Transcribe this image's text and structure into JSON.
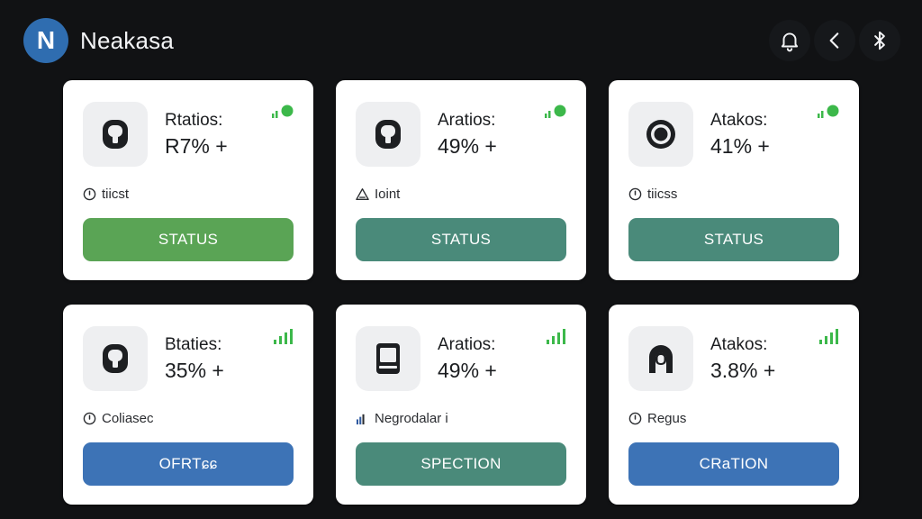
{
  "app": {
    "logo_letter": "N",
    "title": "Neakasa"
  },
  "header": {
    "icons": [
      "bell-icon",
      "back-icon",
      "bluetooth-icon"
    ]
  },
  "colors": {
    "green": "#5aa455",
    "teal": "#4a8a7a",
    "blue": "#3d73b6",
    "signal": "#3cb84a"
  },
  "cards": [
    {
      "label": "Rtatios:",
      "value": "R7% +",
      "meta": "tiicst",
      "meta_icon": "clock-icon",
      "button": "STATUS",
      "button_color": "green",
      "icon": "robot-vacuum-icon",
      "signal": "dot"
    },
    {
      "label": "Aratios:",
      "value": "49% +",
      "meta": "Ioint",
      "meta_icon": "warning-icon",
      "button": "STATUS",
      "button_color": "teal",
      "icon": "robot-vacuum-icon",
      "signal": "dot"
    },
    {
      "label": "Atakos:",
      "value": "41% +",
      "meta": "tiicss",
      "meta_icon": "clock-icon",
      "button": "STATUS",
      "button_color": "teal",
      "icon": "target-icon",
      "signal": "dot"
    },
    {
      "label": "Btaties:",
      "value": "35% +",
      "meta": "Coliasec",
      "meta_icon": "clock-icon",
      "button": "OFRTɕɕ",
      "button_color": "blue",
      "icon": "robot-vacuum-icon",
      "signal": "bars"
    },
    {
      "label": "Aratios:",
      "value": "49% +",
      "meta": "Negrodalar i",
      "meta_icon": "chart-icon",
      "button": "SPECTION",
      "button_color": "teal",
      "icon": "device-icon",
      "signal": "bars"
    },
    {
      "label": "Atakos:",
      "value": "3.8% +",
      "meta": "Regus",
      "meta_icon": "clock-icon",
      "button": "CRaTION",
      "button_color": "blue",
      "icon": "arch-icon",
      "signal": "bars"
    }
  ]
}
